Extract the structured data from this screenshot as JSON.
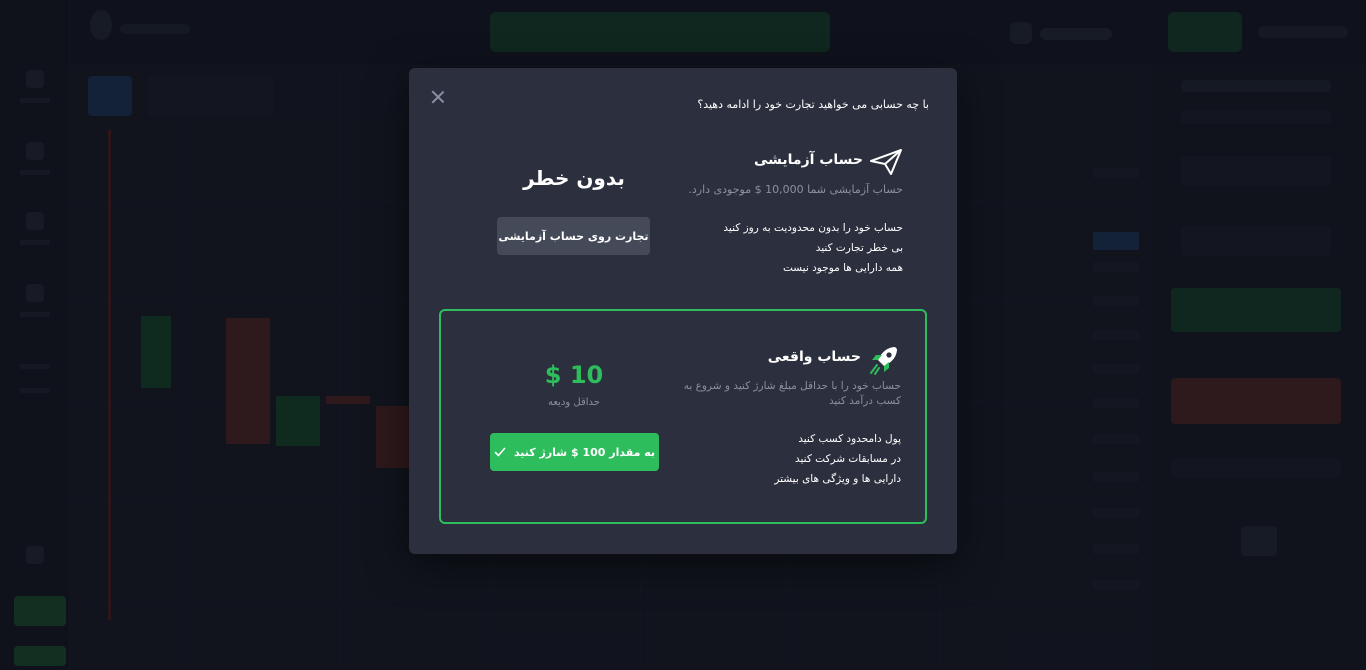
{
  "colors": {
    "accent_green": "#2ebd5c",
    "modal_bg": "#2c303e",
    "muted_text": "#8b90a0",
    "secondary_button": "#454a59"
  },
  "modal": {
    "question": "با چه حسابی می خواهید تجارت خود را ادامه دهید؟",
    "close_icon": "close-icon",
    "demo": {
      "icon": "paper-plane-icon",
      "title": "حساب آزمایشی",
      "balance_text": "حساب آزمایشی شما 10,000 $ موجودی دارد.",
      "features": [
        "حساب خود را بدون محدودیت به روز کنید",
        "بی خطر تجارت کنید",
        "همه دارایی ها موجود نیست"
      ],
      "risk_free_label": "بدون خطر",
      "button_label": "تجارت روی حساب آزمایشی"
    },
    "real": {
      "icon": "rocket-icon",
      "title": "حساب واقعی",
      "description": "حساب خود را با حداقل مبلغ شارژ کنید و شروع به کسب درآمد کنید",
      "features": [
        "پول دامحدود کسب کنید",
        "در مسابقات شرکت کنید",
        "دارایی ها و ویژگی های بیشتر"
      ],
      "min_amount": "$ 10",
      "min_label": "حداقل ودیعه",
      "button_label": "به مقدار 100 $ شارژ کنید",
      "button_icon": "check-icon"
    }
  }
}
